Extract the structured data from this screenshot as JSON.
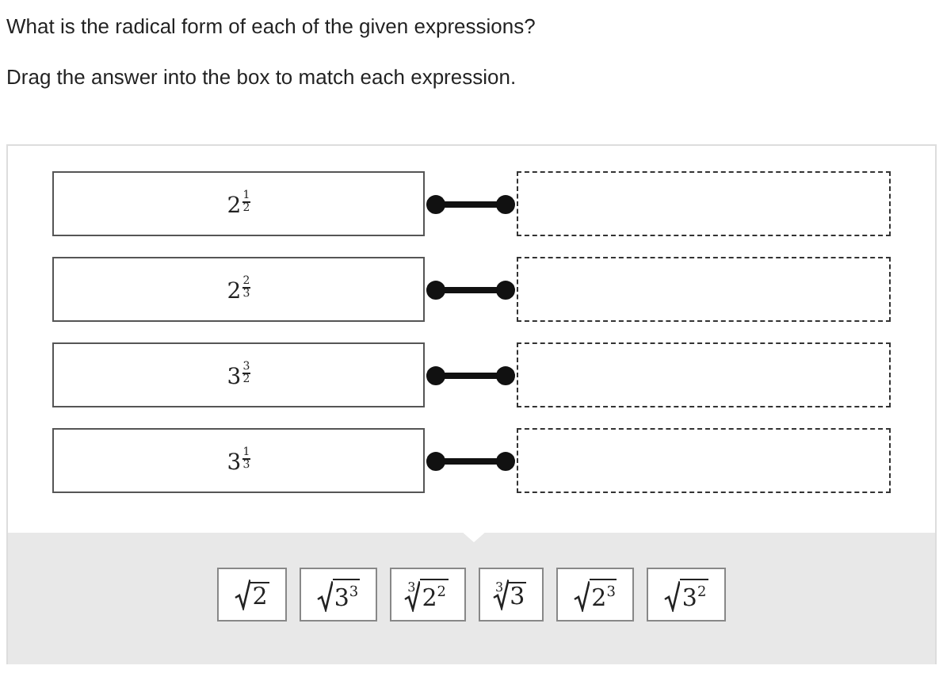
{
  "question": "What is the radical form of each of the given expressions?",
  "instruction": "Drag the answer into the box to match each expression.",
  "expressions": [
    {
      "base": "2",
      "numerator": "1",
      "denominator": "2"
    },
    {
      "base": "2",
      "numerator": "2",
      "denominator": "3"
    },
    {
      "base": "3",
      "numerator": "3",
      "denominator": "2"
    },
    {
      "base": "3",
      "numerator": "1",
      "denominator": "3"
    }
  ],
  "answers": [
    {
      "radicand": "2"
    },
    {
      "radicand": "3",
      "exponent": "3"
    },
    {
      "index": "3",
      "radicand": "2",
      "exponent": "2"
    },
    {
      "index": "3",
      "radicand": "3"
    },
    {
      "radicand": "2",
      "exponent": "3"
    },
    {
      "radicand": "3",
      "exponent": "2"
    }
  ]
}
